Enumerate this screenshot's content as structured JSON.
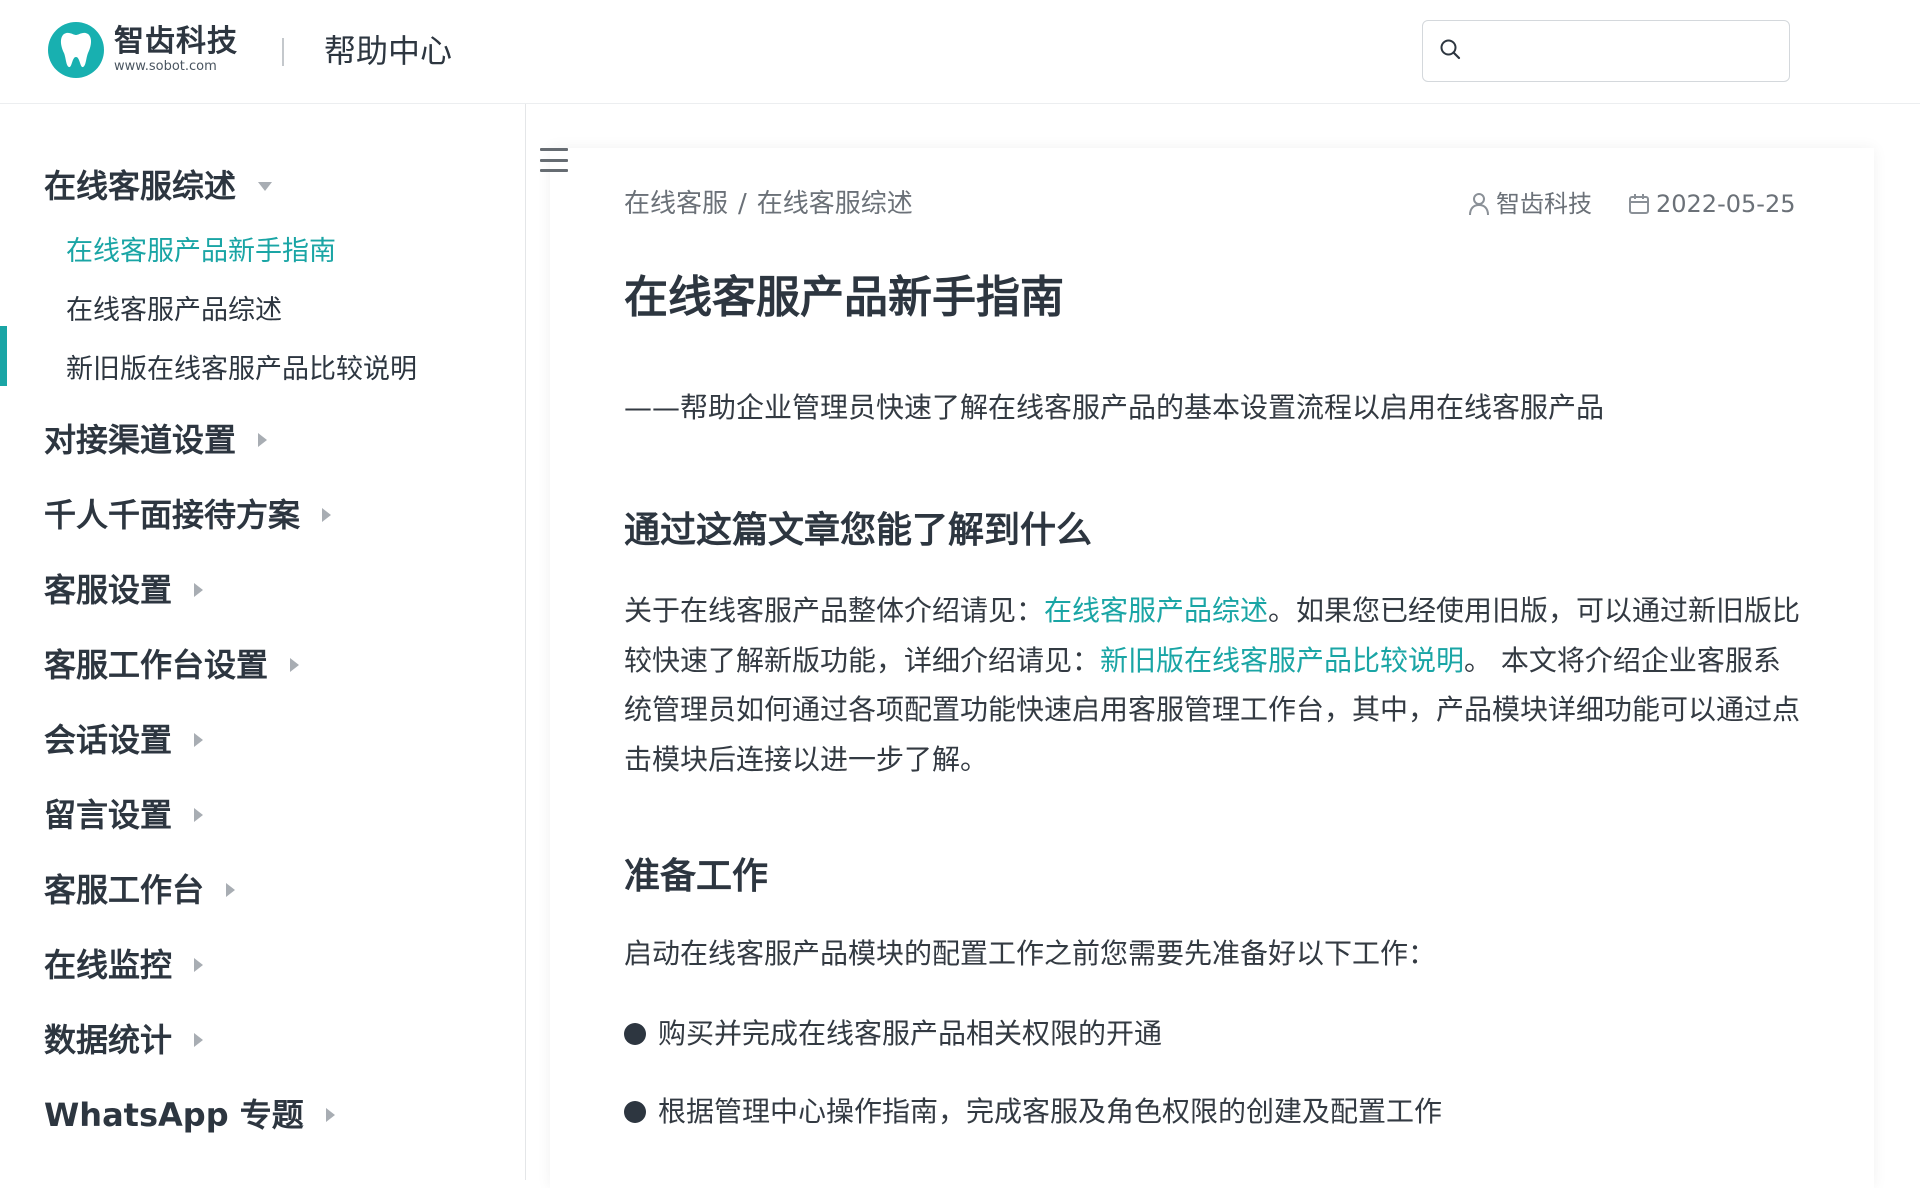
{
  "header": {
    "logo_name": "智齿科技",
    "logo_url": "www.sobot.com",
    "title": "帮助中心",
    "search_placeholder": ""
  },
  "sidebar": {
    "groups": [
      {
        "label": "在线客服综述",
        "expanded": true,
        "items": [
          "在线客服产品新手指南",
          "在线客服产品综述",
          "新旧版在线客服产品比较说明"
        ]
      },
      {
        "label": "对接渠道设置",
        "expanded": false
      },
      {
        "label": "千人千面接待方案",
        "expanded": false
      },
      {
        "label": "客服设置",
        "expanded": false
      },
      {
        "label": "客服工作台设置",
        "expanded": false
      },
      {
        "label": "会话设置",
        "expanded": false
      },
      {
        "label": "留言设置",
        "expanded": false
      },
      {
        "label": "客服工作台",
        "expanded": false
      },
      {
        "label": "在线监控",
        "expanded": false
      },
      {
        "label": "数据统计",
        "expanded": false
      },
      {
        "label": "WhatsApp 专题",
        "expanded": false
      }
    ],
    "active_item": "在线客服产品新手指南"
  },
  "article": {
    "breadcrumb": [
      "在线客服",
      "在线客服综述"
    ],
    "breadcrumb_sep": "/",
    "author": "智齿科技",
    "date": "2022-05-25",
    "title": "在线客服产品新手指南",
    "lead": "——帮助企业管理员快速了解在线客服产品的基本设置流程以启用在线客服产品",
    "section1_heading": "通过这篇文章您能了解到什么",
    "para1_a": "关于在线客服产品整体介绍请见：",
    "para1_link1": "在线客服产品综述",
    "para1_b": "。如果您已经使用旧版，可以通过新旧版比较快速了解新版功能，详细介绍请见：",
    "para1_link2": "新旧版在线客服产品比较说明",
    "para1_c": "。 本文将介绍企业客服系统管理员如何通过各项配置功能快速启用客服管理工作台，其中，产品模块详细功能可以通过点击模块后连接以进一步了解。",
    "section2_heading": "准备工作",
    "prep_intro": "启动在线客服产品模块的配置工作之前您需要先准备好以下工作：",
    "bullets": [
      "购买并完成在线客服产品相关权限的开通",
      "根据管理中心操作指南，完成客服及角色权限的创建及配置工作"
    ]
  },
  "colors": {
    "accent": "#1aa5a5",
    "text_dark": "#2d3640",
    "text_muted": "#6b7178"
  }
}
